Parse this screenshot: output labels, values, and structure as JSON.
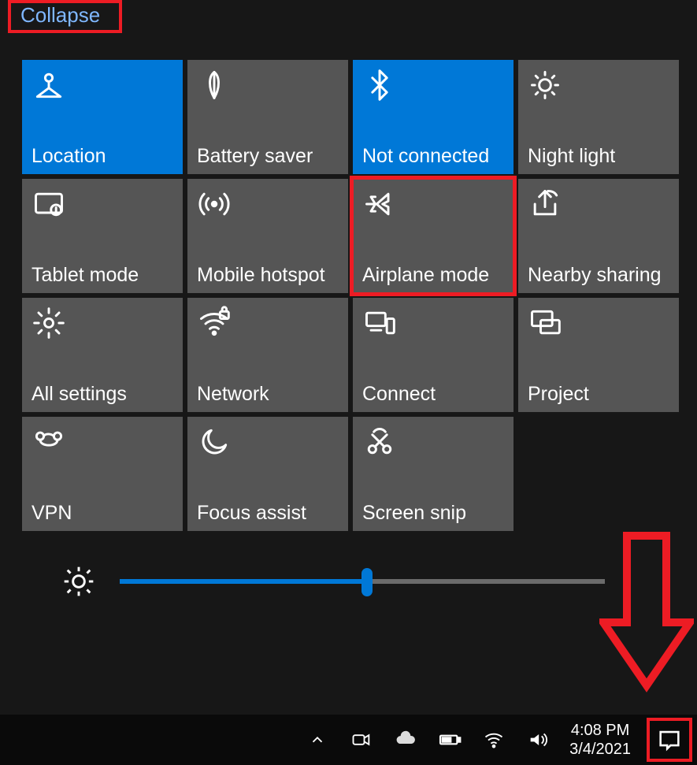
{
  "collapse_label": "Collapse",
  "tiles": [
    {
      "label": "Location",
      "icon": "location",
      "active": true
    },
    {
      "label": "Battery saver",
      "icon": "leaf",
      "active": false
    },
    {
      "label": "Not connected",
      "icon": "bluetooth",
      "active": true
    },
    {
      "label": "Night light",
      "icon": "nightlight",
      "active": false
    },
    {
      "label": "Tablet mode",
      "icon": "tablet",
      "active": false
    },
    {
      "label": "Mobile hotspot",
      "icon": "hotspot",
      "active": false
    },
    {
      "label": "Airplane mode",
      "icon": "airplane",
      "active": false,
      "highlight": true
    },
    {
      "label": "Nearby sharing",
      "icon": "share",
      "active": false
    },
    {
      "label": "All settings",
      "icon": "gear",
      "active": false
    },
    {
      "label": "Network",
      "icon": "wifi-locked",
      "active": false
    },
    {
      "label": "Connect",
      "icon": "connect",
      "active": false
    },
    {
      "label": "Project",
      "icon": "project",
      "active": false
    },
    {
      "label": "VPN",
      "icon": "vpn",
      "active": false
    },
    {
      "label": "Focus assist",
      "icon": "moon",
      "active": false
    },
    {
      "label": "Screen snip",
      "icon": "snip",
      "active": false
    }
  ],
  "brightness_percent": 51,
  "tray": {
    "time": "4:08 PM",
    "date": "3/4/2021"
  }
}
